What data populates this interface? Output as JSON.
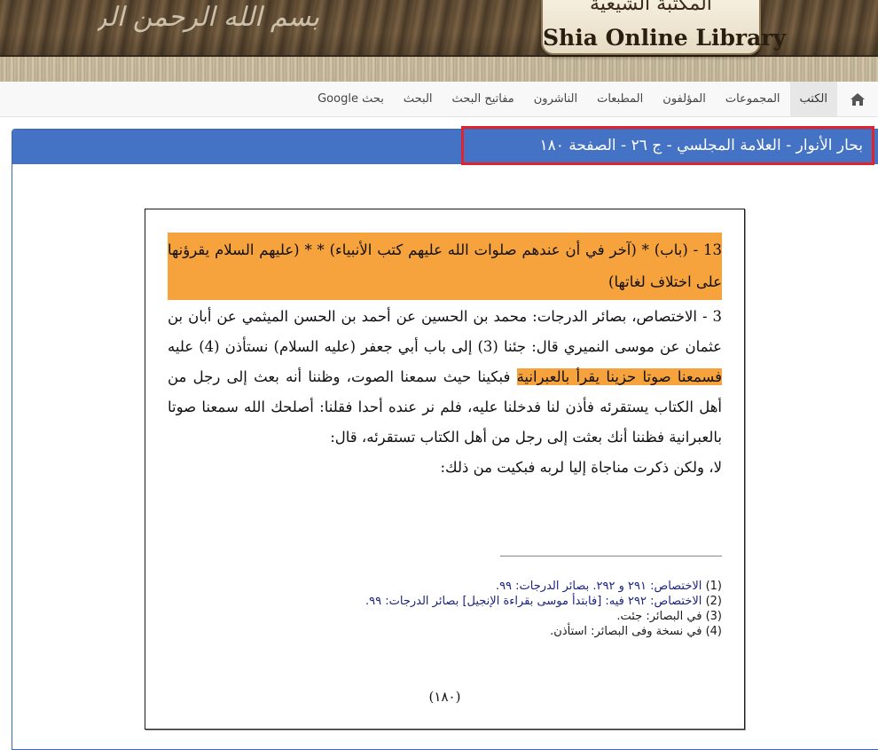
{
  "header": {
    "logo_ar": "المكتبة الشيعية",
    "logo_en": "Shia Online Library",
    "calligraphy": "بسم الله الرحمن الرحيم"
  },
  "nav": {
    "home_icon": "home-icon",
    "items": [
      {
        "label": "الكتب",
        "active": true
      },
      {
        "label": "المجموعات"
      },
      {
        "label": "المؤلفون"
      },
      {
        "label": "المطبعات"
      },
      {
        "label": "الناشرون"
      },
      {
        "label": "مفاتيح البحث"
      },
      {
        "label": "البحث"
      },
      {
        "label": "بحث Google"
      }
    ]
  },
  "panel": {
    "title": "بحار الأنوار - العلامة المجلسي - ج ٢٦ - الصفحة ١٨٠"
  },
  "page": {
    "chapter_title": "13 - (باب) * (آخر في أن عندهم صلوات الله عليهم كتب الأنبياء) * * (عليهم السلام يقرؤنها على اختلاف لغاتها)",
    "paragraph_before": "3 - الاختصاص، بصائر الدرجات: محمد بن الحسين عن أحمد بن الحسن الميثمي عن أبان بن عثمان عن موسى النميري قال: جئنا (3) إلى باب أبي جعفر (عليه السلام) نستأذن (4) عليه",
    "paragraph_highlight": "فسمعنا صوتا حزينا يقرأ بالعبرانية",
    "paragraph_after": "فبكينا حيث سمعنا الصوت، وظننا أنه بعث إلى رجل من أهل الكتاب يستقرئه فأذن لنا فدخلنا عليه، فلم نر عنده أحدا فقلنا: أصلحك الله سمعنا صوتا بالعبرانية فظننا أنك بعثت إلى رجل من أهل الكتاب تستقرئه، قال:",
    "paragraph_last": "لا، ولكن ذكرت مناجاة إليا لربه فبكيت من ذلك:",
    "footnotes": [
      {
        "num": "(1)",
        "text": "الاختصاص: ٢٩١ و ٢٩٢. بصائر الدرجات: ٩٩."
      },
      {
        "num": "(2)",
        "text": "الاختصاص: ٢٩٢ فيه: [فابتدأ موسى بقراءة الإنجيل] بصائر الدرجات: ٩٩."
      },
      {
        "num": "(3)",
        "text": "في البصائر: جئت."
      },
      {
        "num": "(4)",
        "text": "في نسخة وفى البصائر: استأذن."
      }
    ],
    "page_number": "(١٨٠)"
  },
  "colors": {
    "panel_blue": "#4472c4",
    "highlight_orange": "#f6a23d",
    "title_box_red": "#e0232d"
  }
}
